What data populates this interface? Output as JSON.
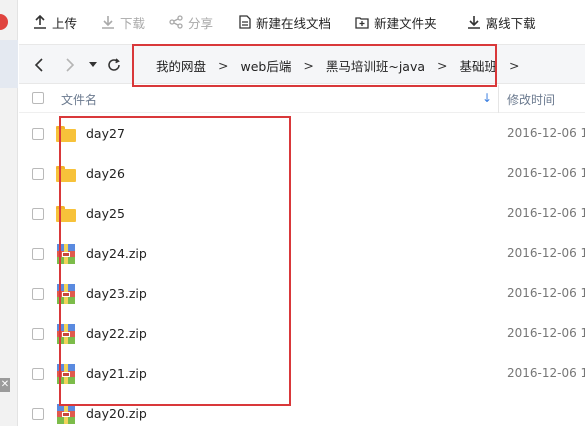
{
  "toolbar": {
    "upload": "上传",
    "download": "下载",
    "share": "分享",
    "new_doc": "新建在线文档",
    "new_folder": "新建文件夹",
    "offline": "离线下载"
  },
  "breadcrumb": [
    "我的网盘",
    "web后端",
    "黑马培训班~java",
    "基础班"
  ],
  "breadcrumb_sep": ">",
  "header": {
    "name": "文件名",
    "sort_arrow": "↓",
    "modified": "修改时间"
  },
  "files": [
    {
      "name": "day27",
      "type": "folder",
      "time": "2016-12-06 1"
    },
    {
      "name": "day26",
      "type": "folder",
      "time": "2016-12-06 1"
    },
    {
      "name": "day25",
      "type": "folder",
      "time": "2016-12-06 1"
    },
    {
      "name": "day24.zip",
      "type": "zip",
      "time": "2016-12-06 1"
    },
    {
      "name": "day23.zip",
      "type": "zip",
      "time": "2016-12-06 1"
    },
    {
      "name": "day22.zip",
      "type": "zip",
      "time": "2016-12-06 1"
    },
    {
      "name": "day21.zip",
      "type": "zip",
      "time": "2016-12-06 1"
    },
    {
      "name": "day20.zip",
      "type": "zip",
      "time": ""
    }
  ],
  "colors": {
    "highlight_box": "#d9383a",
    "folder": "#f7c23a",
    "accent": "#3a7ee0"
  }
}
